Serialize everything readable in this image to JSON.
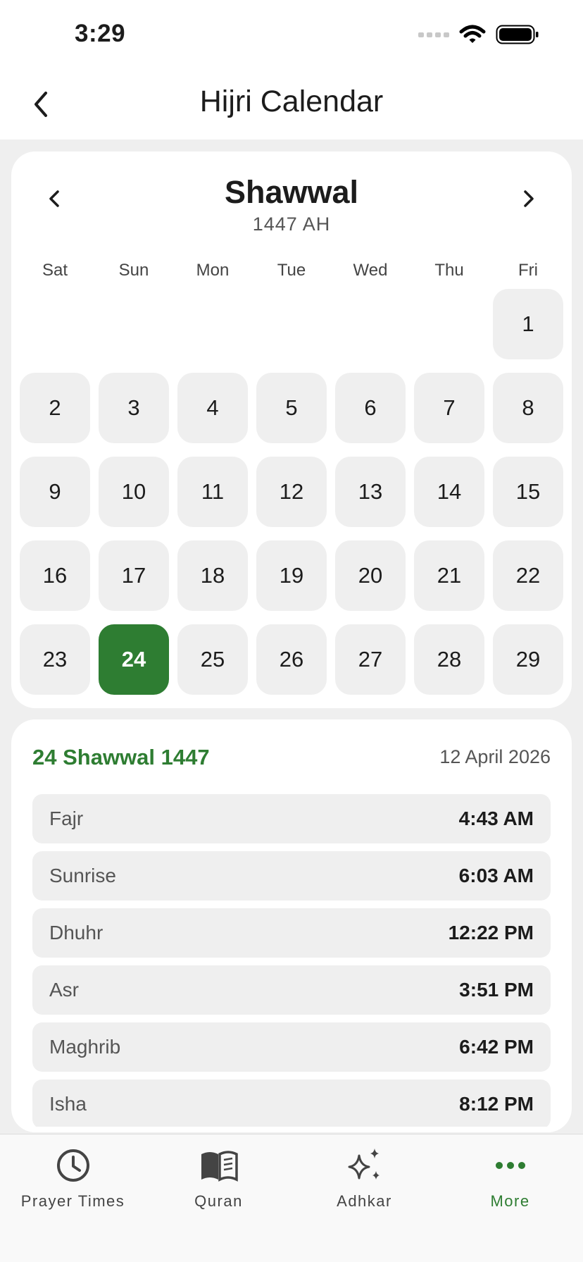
{
  "status_bar": {
    "time": "3:29"
  },
  "header": {
    "title": "Hijri Calendar"
  },
  "calendar": {
    "month": "Shawwal",
    "year": "1447 AH",
    "weekdays": [
      "Sat",
      "Sun",
      "Mon",
      "Tue",
      "Wed",
      "Thu",
      "Fri"
    ],
    "first_day_column": 6,
    "days_in_month": 29,
    "selected_day": 24
  },
  "details": {
    "hijri_date": "24 Shawwal 1447",
    "gregorian_date": "12 April 2026",
    "prayers": [
      {
        "name": "Fajr",
        "time": "4:43 AM"
      },
      {
        "name": "Sunrise",
        "time": "6:03 AM"
      },
      {
        "name": "Dhuhr",
        "time": "12:22 PM"
      },
      {
        "name": "Asr",
        "time": "3:51 PM"
      },
      {
        "name": "Maghrib",
        "time": "6:42 PM"
      },
      {
        "name": "Isha",
        "time": "8:12 PM"
      }
    ]
  },
  "tab_bar": {
    "items": [
      {
        "label": "Prayer Times",
        "icon": "clock-icon"
      },
      {
        "label": "Quran",
        "icon": "book-icon"
      },
      {
        "label": "Adhkar",
        "icon": "sparkles-icon"
      },
      {
        "label": "More",
        "icon": "more-icon",
        "active": true
      }
    ]
  },
  "colors": {
    "accent": "#2e7d32",
    "background": "#efefef",
    "card": "#ffffff"
  }
}
